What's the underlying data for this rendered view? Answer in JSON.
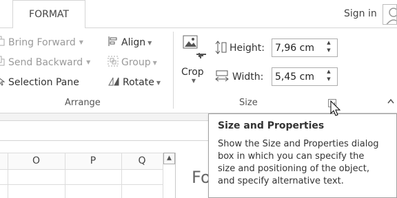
{
  "tabs": {
    "active": "FORMAT"
  },
  "header": {
    "sign_in": "Sign in"
  },
  "arrange": {
    "bring_forward": "Bring Forward",
    "send_backward": "Send Backward",
    "selection_pane": "Selection Pane",
    "align": "Align",
    "group": "Group",
    "rotate": "Rotate",
    "label": "Arrange"
  },
  "size": {
    "crop": "Crop",
    "height_label": "Height:",
    "height_value": "7,96 cm",
    "width_label": "Width:",
    "width_value": "5,45 cm",
    "label": "Size"
  },
  "worksheet": {
    "columns": [
      "O",
      "P",
      "Q"
    ],
    "partial_text": "Fo"
  },
  "tooltip": {
    "title": "Size and Properties",
    "lines": [
      "Show the Size and Properties dialog",
      "box in which you can specify the",
      "size and positioning of the object,",
      "and specify alternative text."
    ]
  },
  "colors": {
    "tab_border": "#d5d5d5",
    "ribbon_text": "#333333",
    "disabled_text": "#9a9a9a",
    "input_border": "#adadad"
  }
}
